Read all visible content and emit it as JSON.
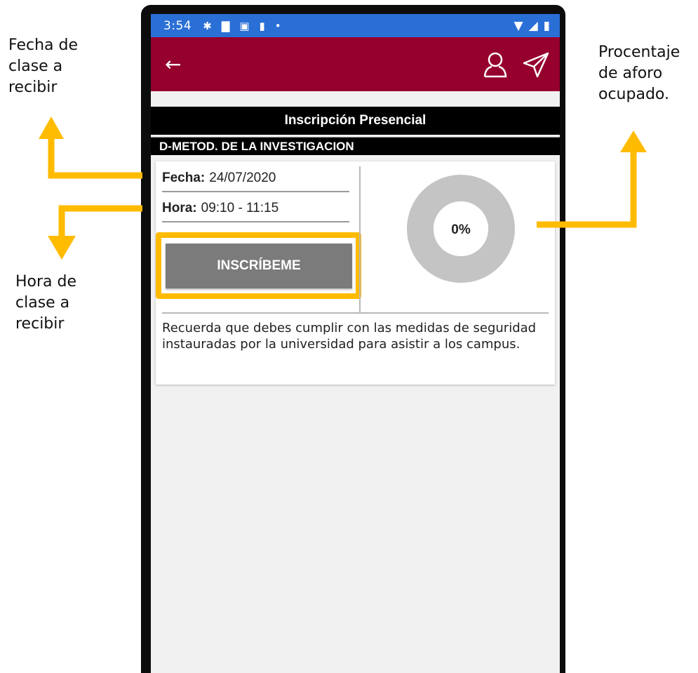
{
  "annotations": {
    "fecha": "Fecha de\nclase a\nrecibir",
    "hora": "Hora de\nclase a\nrecibir",
    "aforo": "Procentaje\nde aforo\nocupado."
  },
  "statusbar": {
    "time": "3:54",
    "icons": [
      "gear-icon",
      "message-icon",
      "a-icon",
      "sd-card-icon",
      "dot-icon"
    ],
    "right_icons": [
      "wifi-icon",
      "signal-icon",
      "battery-icon"
    ]
  },
  "appbar": {
    "color": "#95002d",
    "icons": [
      "back-arrow-icon",
      "user-icon",
      "send-icon"
    ]
  },
  "page": {
    "title": "Inscripción Presencial",
    "subject": "D-METOD. DE LA INVESTIGACION"
  },
  "card": {
    "fecha_label": "Fecha:",
    "fecha_value": "24/07/2020",
    "hora_label": "Hora:",
    "hora_value": "09:10 - 11:15",
    "button_label": "INSCRÍBEME",
    "occupancy_label": "0%",
    "occupancy_value": 0,
    "notice": "Recuerda que debes cumplir con las medidas de seguridad instauradas por la universidad para asistir a los campus."
  },
  "colors": {
    "highlight": "#ffbb00",
    "statusbar": "#2a6fd6",
    "button": "#7b7b7b",
    "donut": "#c4c4c4"
  }
}
